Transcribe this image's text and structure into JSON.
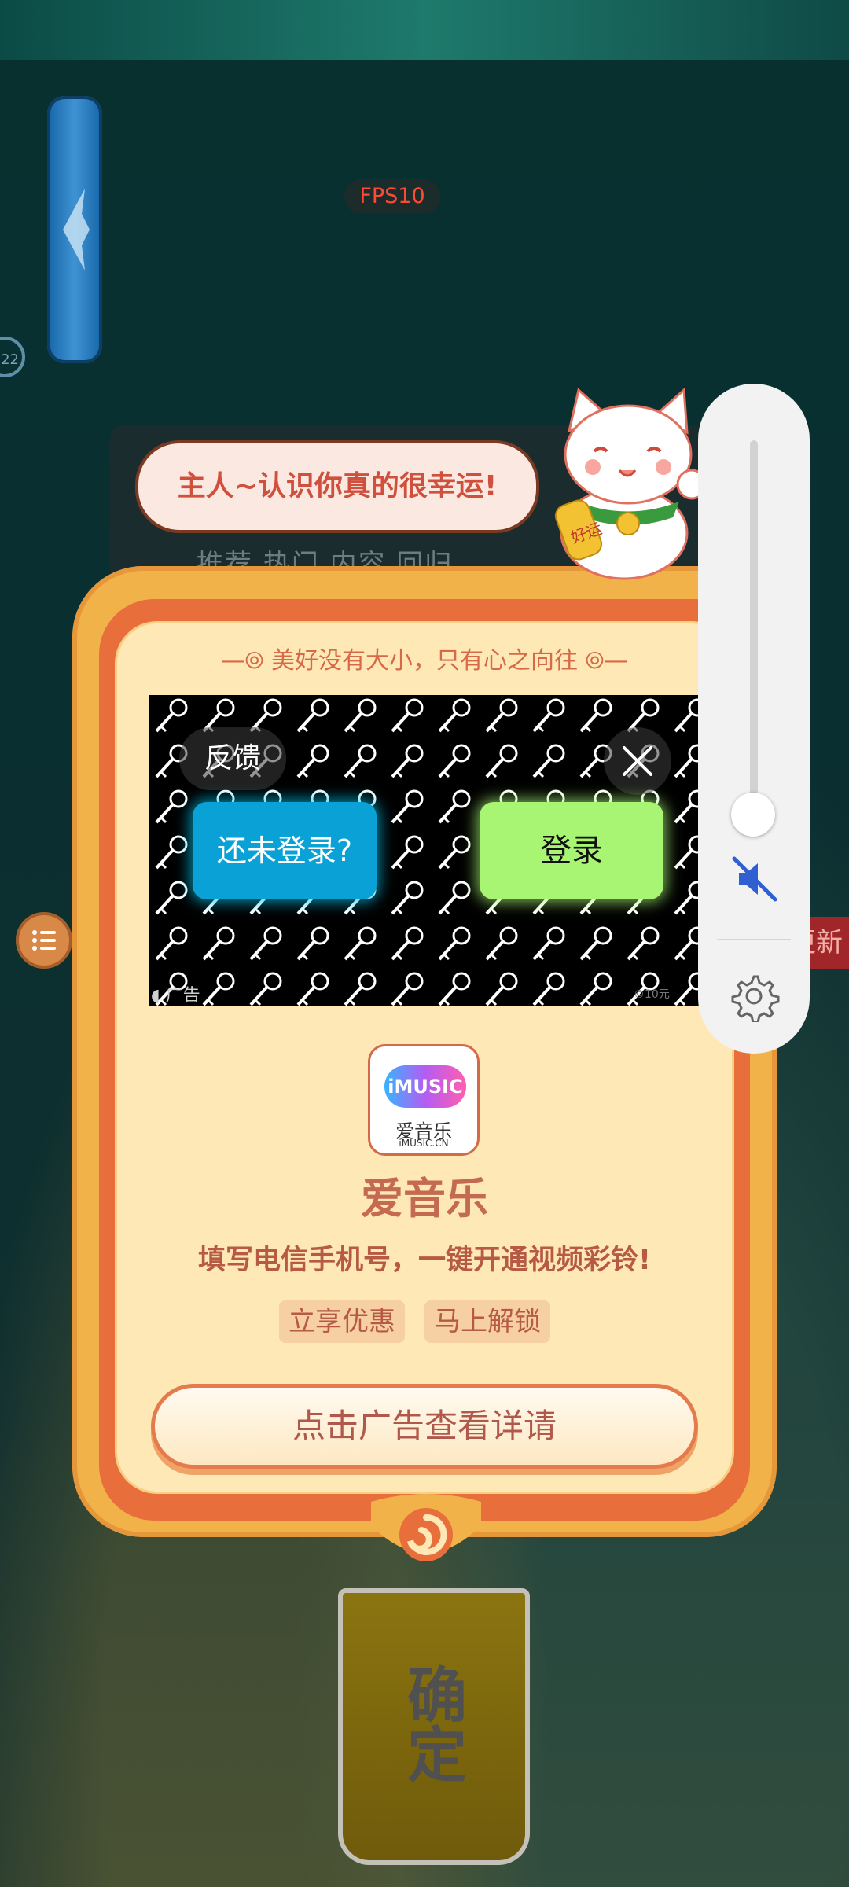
{
  "hud": {
    "fps": "FPS10",
    "side_num": "22",
    "new_label": "更新"
  },
  "background_panel": {
    "tabs": "推荐 热门 内容 回归"
  },
  "popup": {
    "speech": "主人~认识你真的很幸运!",
    "motto": "美好没有大小，只有心之向往",
    "ad": {
      "feedback_label": "反馈",
      "not_logged_label": "还未登录?",
      "login_label": "登录",
      "ad_label": "广告",
      "ad_label_right": "©10元"
    },
    "app": {
      "logo_text": "iMUSIC",
      "logo_cn": "爱音乐",
      "logo_en": "iMUSIC.CN",
      "name": "爱音乐",
      "desc": "填写电信手机号，一键开通视频彩铃!",
      "tags": [
        "立享优惠",
        "马上解锁"
      ]
    },
    "cta_label": "点击广告查看详请"
  },
  "confirm_label": "确定",
  "cat_charm": "好运",
  "volume": {
    "level": 0,
    "muted": true
  },
  "colors": {
    "accent_orange": "#e86e3c",
    "frame_gold": "#f2b24a",
    "login_green": "#a7f572",
    "blue_button": "#0aa2d6"
  }
}
